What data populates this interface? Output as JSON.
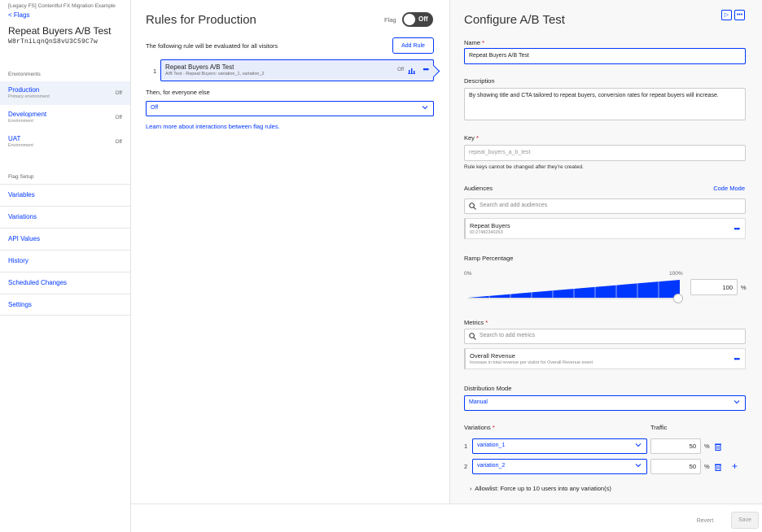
{
  "sidebar": {
    "breadcrumb": "[Legacy FS] Contentful FX Migration Example",
    "back_label": "< Flags",
    "flag_title": "Repeat Buyers A/B Test",
    "flag_key": "W8rTniLqnQnS8vU3C59C7w",
    "environments_heading": "Environments",
    "environments": [
      {
        "name": "Production",
        "sub": "Primary environment",
        "status": "Off"
      },
      {
        "name": "Development",
        "sub": "Environment",
        "status": "Off"
      },
      {
        "name": "UAT",
        "sub": "Environment",
        "status": "Off"
      }
    ],
    "setup_heading": "Flag Setup",
    "setup_items": [
      "Variables",
      "Variations",
      "API Values",
      "History",
      "Scheduled Changes",
      "Settings"
    ]
  },
  "rules": {
    "title": "Rules for Production",
    "flag_label": "Flag",
    "toggle_label": "Off",
    "description": "The following rule will be evaluated for all visitors",
    "add_rule_label": "Add Rule",
    "rule": {
      "number": "1",
      "name": "Repeat Buyers A/B Test",
      "sub": "A/B Test - Repeat Buyers: variation_1, variation_2",
      "status": "Off"
    },
    "else_label": "Then, for everyone else",
    "else_value": "Off",
    "learn_link": "Learn more about interactions between flag rules."
  },
  "config": {
    "title": "Configure A/B Test",
    "name_label": "Name",
    "name_value": "Repeat Buyers A/B Test",
    "description_label": "Description",
    "description_value": "By showing title and CTA tailored to repeat buyers, conversion rates for repeat buyers will increase.",
    "key_label": "Key",
    "key_value": "repeat_buyers_a_b_test",
    "key_hint": "Rule keys cannot be changed after they're created.",
    "audiences_label": "Audiences",
    "code_mode_label": "Code Mode",
    "audience_search_placeholder": "Search and add audiences",
    "audience": {
      "name": "Repeat Buyers",
      "id": "ID:27482340263"
    },
    "ramp_label": "Ramp Percentage",
    "ramp_min": "0%",
    "ramp_max": "100%",
    "ramp_value": "100",
    "ramp_fraction": 1.0,
    "percent_sign": "%",
    "metrics_label": "Metrics",
    "metrics_search_placeholder": "Search to add metrics",
    "metric": {
      "name": "Overall Revenue",
      "sub": "Increase in total revenue per visitor for Overall Revenue event"
    },
    "distribution_label": "Distribution Mode",
    "distribution_value": "Manual",
    "variations_label": "Variations",
    "traffic_label": "Traffic",
    "variations": [
      {
        "number": "1",
        "name": "variation_1",
        "traffic": "50"
      },
      {
        "number": "2",
        "name": "variation_2",
        "traffic": "50"
      }
    ],
    "allowlist_label": "Allowlist: Force up to 10 users into any variation(s)"
  },
  "footer": {
    "revert_label": "Revert",
    "save_label": "Save"
  },
  "colors": {
    "accent": "#0037ff",
    "toggle_off": "#444444",
    "required": "#d0021b"
  }
}
